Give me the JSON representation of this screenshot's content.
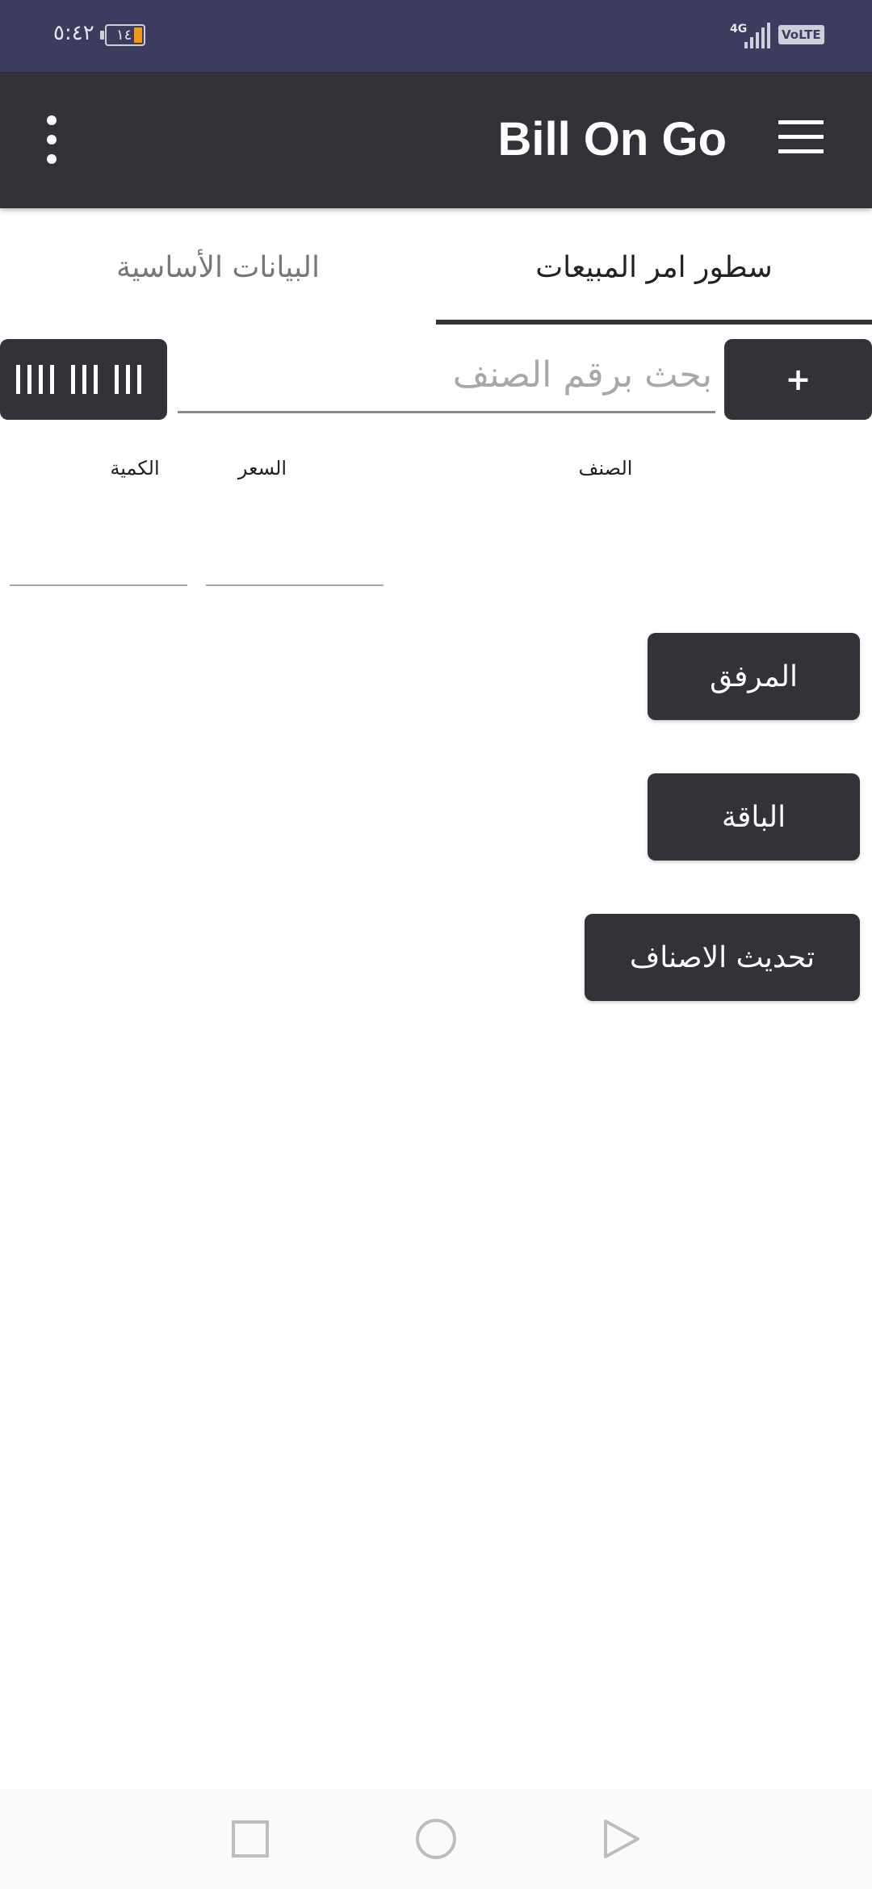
{
  "status_bar": {
    "time": "٥:٤٢",
    "battery_level": "١٤",
    "network": "4G",
    "volte": "VoLTE"
  },
  "app_bar": {
    "title": "Bill On Go"
  },
  "tabs": [
    {
      "label": "سطور امر المبيعات",
      "selected": true
    },
    {
      "label": "البيانات الأساسية",
      "selected": false
    }
  ],
  "search": {
    "add_label": "+",
    "placeholder": "بحث برقم الصنف",
    "value": ""
  },
  "columns": {
    "item": "الصنف",
    "price": "السعر",
    "quantity": "الكمية"
  },
  "line": {
    "price": "",
    "quantity": ""
  },
  "buttons": {
    "attachment": "المرفق",
    "package": "الباقة",
    "refresh_items": "تحديث الاصناف"
  },
  "colors": {
    "status_bar": "#3c3c5e",
    "primary": "#323238",
    "battery_low": "#f09a1a"
  },
  "icons": {
    "menu": "hamburger-icon",
    "more": "kebab-icon",
    "barcode": "barcode-icon",
    "nav_recents": "square-icon",
    "nav_home": "circle-icon",
    "nav_back": "triangle-icon"
  }
}
